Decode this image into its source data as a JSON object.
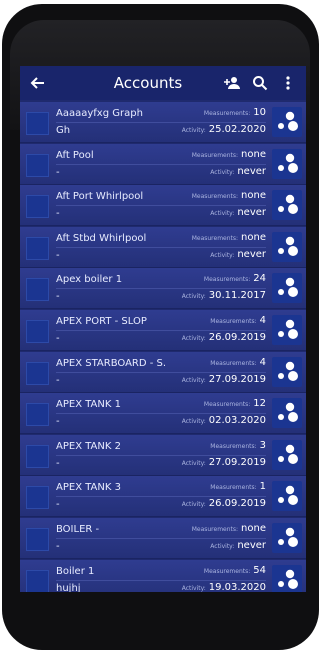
{
  "header": {
    "title": "Accounts"
  },
  "labels": {
    "measurements": "Measurements:",
    "activity": "Activity:"
  },
  "icons": {
    "back": "arrow-left-icon",
    "add_user": "add-user-icon",
    "search": "search-icon",
    "more": "more-vert-icon",
    "row": "graph-nodes-icon"
  },
  "accounts": [
    {
      "name": "Aaaaayfxg Graph",
      "sub": "Gh",
      "measurements": "10",
      "activity": "25.02.2020"
    },
    {
      "name": "Aft Pool",
      "sub": "-",
      "measurements": "none",
      "activity": "never"
    },
    {
      "name": "Aft Port Whirlpool",
      "sub": "-",
      "measurements": "none",
      "activity": "never"
    },
    {
      "name": "Aft Stbd Whirlpool",
      "sub": "-",
      "measurements": "none",
      "activity": "never"
    },
    {
      "name": "Apex boiler 1",
      "sub": "-",
      "measurements": "24",
      "activity": "30.11.2017"
    },
    {
      "name": "APEX PORT - SLOP",
      "sub": "-",
      "measurements": "4",
      "activity": "26.09.2019"
    },
    {
      "name": "APEX STARBOARD - S...",
      "sub": "-",
      "measurements": "4",
      "activity": "27.09.2019"
    },
    {
      "name": "APEX TANK 1",
      "sub": "-",
      "measurements": "12",
      "activity": "02.03.2020"
    },
    {
      "name": "APEX TANK 2",
      "sub": "-",
      "measurements": "3",
      "activity": "27.09.2019"
    },
    {
      "name": "APEX TANK 3",
      "sub": "-",
      "measurements": "1",
      "activity": "26.09.2019"
    },
    {
      "name": "BOILER -",
      "sub": "-",
      "measurements": "none",
      "activity": "never"
    },
    {
      "name": "Boiler 1",
      "sub": "hujhj",
      "measurements": "54",
      "activity": "19.03.2020"
    }
  ]
}
